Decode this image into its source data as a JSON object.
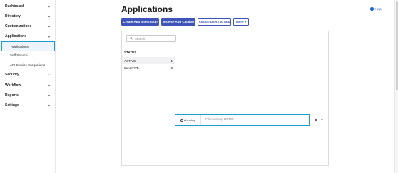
{
  "sidebar": {
    "items": [
      {
        "label": "Dashboard"
      },
      {
        "label": "Directory"
      },
      {
        "label": "Customizations"
      },
      {
        "label": "Applications"
      },
      {
        "label": "Security"
      },
      {
        "label": "Workflow"
      },
      {
        "label": "Reports"
      },
      {
        "label": "Settings"
      }
    ],
    "sub_items": [
      {
        "label": "Applications",
        "selected": true
      },
      {
        "label": "Self Service"
      },
      {
        "label": "API Service Integrations"
      }
    ]
  },
  "header": {
    "title": "Applications",
    "help_label": "Help"
  },
  "toolbar": {
    "create_label": "Create App Integration",
    "browse_label": "Browse App Catalog",
    "assign_label": "Assign Users to App",
    "more_label": "More ▾"
  },
  "search": {
    "placeholder": "Search"
  },
  "status_filter": {
    "heading": "STATUS",
    "rows": [
      {
        "label": "ACTIVE",
        "count": "1"
      },
      {
        "label": "INACTIVE",
        "count": "0"
      }
    ]
  },
  "apps": [
    {
      "logo_text": "zihershop",
      "name": "Chinershop HRMS"
    }
  ],
  "colors": {
    "accent": "#3e54b8",
    "highlight": "#1a9ecf",
    "link": "#1662dd"
  }
}
